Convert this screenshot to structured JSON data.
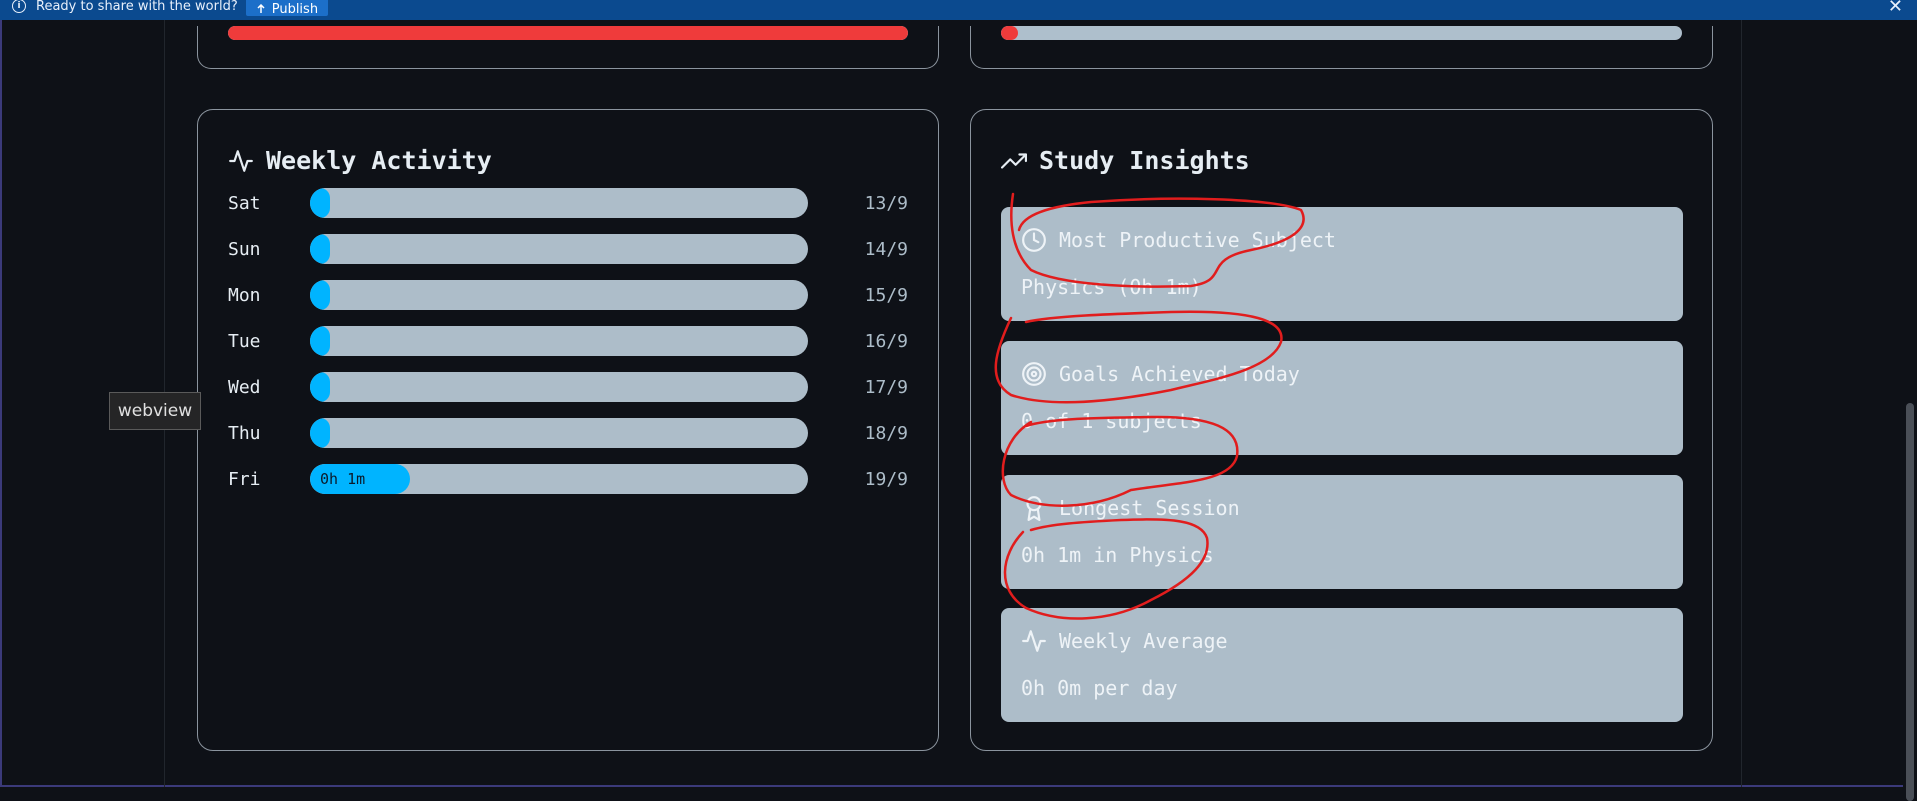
{
  "notification": {
    "message": "Ready to share with the world?",
    "publish_label": "Publish",
    "close_symbol": "✕"
  },
  "top_bars": {
    "left_progress": 1.0,
    "right_progress": 0.025,
    "color": "#ef3b3b"
  },
  "weekly_activity": {
    "title": "Weekly Activity",
    "icon": "activity-icon",
    "days": [
      {
        "day": "Sat",
        "date": "13/9",
        "label": "",
        "fill": 0.04
      },
      {
        "day": "Sun",
        "date": "14/9",
        "label": "",
        "fill": 0.04
      },
      {
        "day": "Mon",
        "date": "15/9",
        "label": "",
        "fill": 0.04
      },
      {
        "day": "Tue",
        "date": "16/9",
        "label": "",
        "fill": 0.04
      },
      {
        "day": "Wed",
        "date": "17/9",
        "label": "",
        "fill": 0.04
      },
      {
        "day": "Thu",
        "date": "18/9",
        "label": "",
        "fill": 0.04
      },
      {
        "day": "Fri",
        "date": "19/9",
        "label": "0h 1m",
        "fill": 0.2
      }
    ],
    "bar_color": "#00b4ff",
    "track_color": "#adbdc9"
  },
  "study_insights": {
    "title": "Study Insights",
    "icon": "trending-up-icon",
    "items": [
      {
        "icon": "clock-icon",
        "heading": "Most Productive Subject",
        "value": "Physics (0h 1m)"
      },
      {
        "icon": "target-icon",
        "heading": "Goals Achieved Today",
        "value": "0 of 1 subjects"
      },
      {
        "icon": "award-icon",
        "heading": "Longest Session",
        "value": "0h 1m in Physics"
      },
      {
        "icon": "activity-icon",
        "heading": "Weekly Average",
        "value": "0h 0m per day"
      }
    ]
  },
  "tooltip": {
    "text": "webview"
  },
  "colors": {
    "background": "#0e1117",
    "notify_bar": "#0b4a8f",
    "annotation": "#e11d1d"
  }
}
